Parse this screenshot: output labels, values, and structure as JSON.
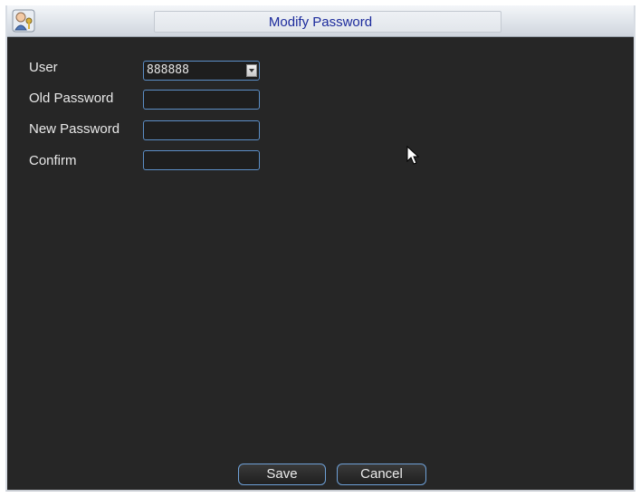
{
  "window": {
    "title": "Modify Password",
    "icon": "user-keys-icon"
  },
  "form": {
    "user_label": "User",
    "user_value": "888888",
    "old_password_label": "Old Password",
    "old_password_value": "",
    "new_password_label": "New Password",
    "new_password_value": "",
    "confirm_label": "Confirm",
    "confirm_value": ""
  },
  "buttons": {
    "save_label": "Save",
    "cancel_label": "Cancel"
  },
  "colors": {
    "background": "#262626",
    "field_border": "#5c8ec6",
    "title_text": "#1b2a9c"
  }
}
